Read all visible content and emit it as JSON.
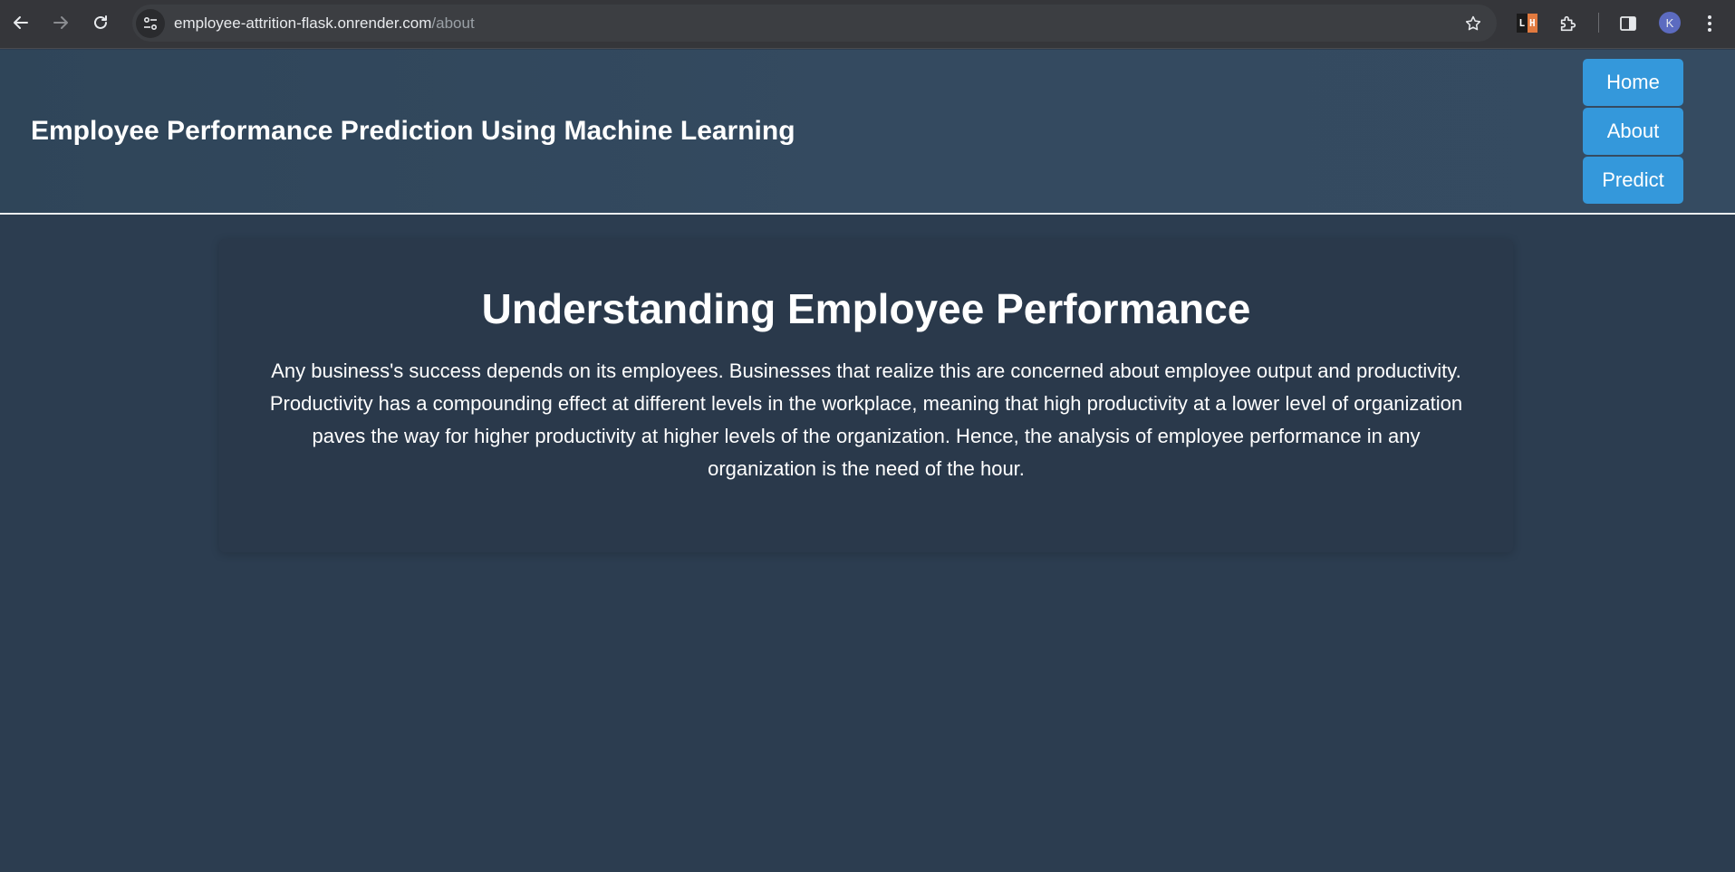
{
  "browser": {
    "url_host": "employee-attrition-flask.onrender.com",
    "url_path": "/about",
    "extension_lh": {
      "left": "L",
      "right": "H"
    },
    "profile_initial": "K",
    "icons": [
      "back-arrow-icon",
      "forward-arrow-icon",
      "reload-icon",
      "site-settings-icon",
      "star-icon",
      "extensions-icon",
      "side-panel-icon",
      "more-menu-icon"
    ]
  },
  "header": {
    "title": "Employee Performance Prediction Using Machine Learning",
    "nav": [
      "Home",
      "About",
      "Predict"
    ]
  },
  "main": {
    "heading": "Understanding Employee Performance",
    "paragraph": "Any business's success depends on its employees. Businesses that realize this are concerned about employee output and productivity. Productivity has a compounding effect at different levels in the workplace, meaning that high productivity at a lower level of organization paves the way for higher productivity at higher levels of the organization. Hence, the analysis of employee performance in any organization is the need of the hour."
  },
  "colors": {
    "page_bg": "#2c3d50",
    "header_bg": "#344a60",
    "card_bg": "#2a394b",
    "nav_button": "#3498db",
    "text": "#ffffff"
  }
}
